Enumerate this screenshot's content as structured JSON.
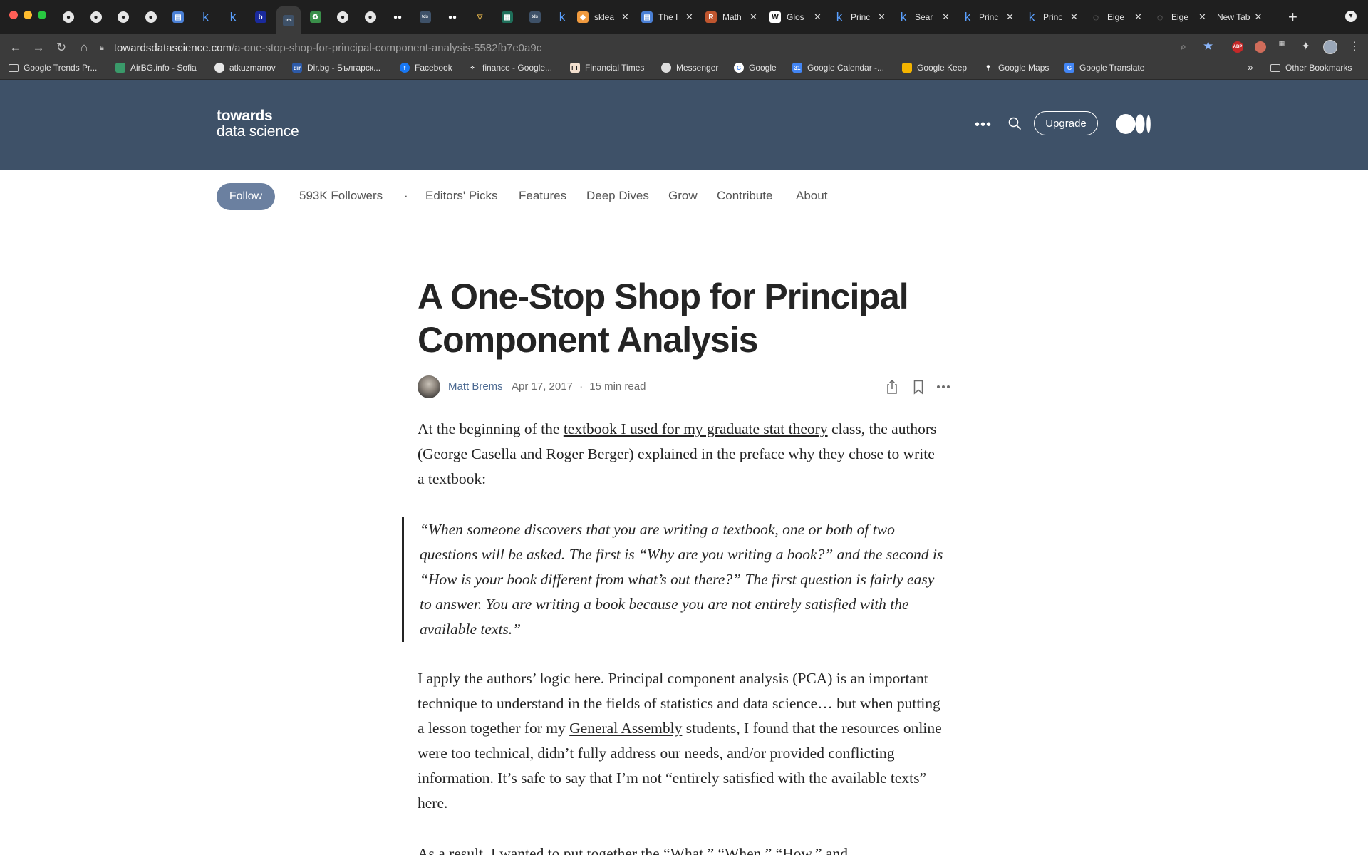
{
  "browser": {
    "tabs": [
      {
        "icon": "github-icon",
        "title": ""
      },
      {
        "icon": "github-icon",
        "title": ""
      },
      {
        "icon": "github-icon",
        "title": ""
      },
      {
        "icon": "github-icon",
        "title": ""
      },
      {
        "icon": "doc-icon",
        "title": ""
      },
      {
        "icon": "kaggle-icon",
        "title": ""
      },
      {
        "icon": "kaggle-icon",
        "title": ""
      },
      {
        "icon": "b-icon",
        "title": ""
      },
      {
        "icon": "tds-icon",
        "title": ""
      },
      {
        "icon": "recycle-icon",
        "title": ""
      },
      {
        "icon": "github-icon",
        "title": ""
      },
      {
        "icon": "github-icon",
        "title": ""
      },
      {
        "icon": "medium-icon",
        "title": ""
      },
      {
        "icon": "tds-icon",
        "title": ""
      },
      {
        "icon": "medium-icon",
        "title": ""
      },
      {
        "icon": "vue-icon",
        "title": ""
      },
      {
        "icon": "chart-icon",
        "title": ""
      },
      {
        "icon": "tds-icon",
        "title": ""
      },
      {
        "icon": "kaggle-icon",
        "title": ""
      }
    ],
    "titled_tabs": [
      {
        "icon": "sklearn-icon",
        "title": "sklea"
      },
      {
        "icon": "doc-icon",
        "title": "The I"
      },
      {
        "icon": "r-icon",
        "title": "Math"
      },
      {
        "icon": "wikipedia-icon",
        "title": "Glos"
      },
      {
        "icon": "kaggle-icon",
        "title": "Princ"
      },
      {
        "icon": "kaggle-icon",
        "title": "Sear"
      },
      {
        "icon": "kaggle-icon",
        "title": "Princ"
      },
      {
        "icon": "kaggle-icon",
        "title": "Princ"
      },
      {
        "icon": "globe-icon",
        "title": "Eige"
      },
      {
        "icon": "globe-icon",
        "title": "Eige"
      }
    ],
    "new_tab_label": "New Tab",
    "url_domain": "towardsdatascience.com",
    "url_path": "/a-one-stop-shop-for-principal-component-analysis-5582fb7e0a9c",
    "bookmarks": [
      {
        "label": "Google Trends Pr...",
        "icon": "folder-icon"
      },
      {
        "label": "AirBG.info - Sofia",
        "icon": "airbg-icon"
      },
      {
        "label": "atkuzmanov",
        "icon": "github-icon"
      },
      {
        "label": "Dir.bg - Българск...",
        "icon": "dir-icon"
      },
      {
        "label": "Facebook",
        "icon": "facebook-icon"
      },
      {
        "label": "finance - Google...",
        "icon": "finance-icon"
      },
      {
        "label": "Financial Times",
        "icon": "ft-icon"
      },
      {
        "label": "Messenger",
        "icon": "messenger-icon"
      },
      {
        "label": "Google",
        "icon": "google-icon"
      },
      {
        "label": "Google Calendar -...",
        "icon": "calendar-icon"
      },
      {
        "label": "Google Keep",
        "icon": "keep-icon"
      },
      {
        "label": "Google Maps",
        "icon": "maps-icon"
      },
      {
        "label": "Google Translate",
        "icon": "translate-icon"
      }
    ],
    "other_bookmarks": "Other Bookmarks",
    "more_bookmarks_glyph": "»"
  },
  "site": {
    "logo_line1": "towards",
    "logo_line2": "data science",
    "upgrade_label": "Upgrade",
    "header_color": "#3e5168"
  },
  "pubnav": {
    "follow_label": "Follow",
    "followers": "593K Followers",
    "separator": "·",
    "items": [
      "Editors' Picks",
      "Features",
      "Deep Dives",
      "Grow",
      "Contribute",
      "About"
    ]
  },
  "article": {
    "title": "A One-Stop Shop for Principal Component Analysis",
    "author": "Matt Brems",
    "date": "Apr 17, 2017",
    "dot": "·",
    "read_time": "15 min read",
    "p1_before": "At the beginning of the ",
    "p1_link": "textbook I used for my graduate stat theory",
    "p1_after": " class, the authors (George Casella and Roger Berger) explained in the preface why they chose to write a textbook:",
    "quote": "“When someone discovers that you are writing a textbook, one or both of two questions will be asked. The first is “Why are you writing a book?” and the second is “How is your book different from what’s out there?” The first question is fairly easy to answer. You are writing a book because you are not entirely satisfied with the available texts.”",
    "p2_before": "I apply the authors’ logic here. Principal component analysis (PCA) is an important technique to understand in the fields of statistics and data science… but when putting a lesson together for my ",
    "p2_link": "General Assembly",
    "p2_after": " students, I found that the resources online were too technical, didn’t fully address our needs, and/or provided conflicting information. It’s safe to say that I’m not “entirely satisfied with the available texts” here.",
    "p3_partial": "As a result, I wanted to put together the “What,” “When,” “How,” and"
  }
}
